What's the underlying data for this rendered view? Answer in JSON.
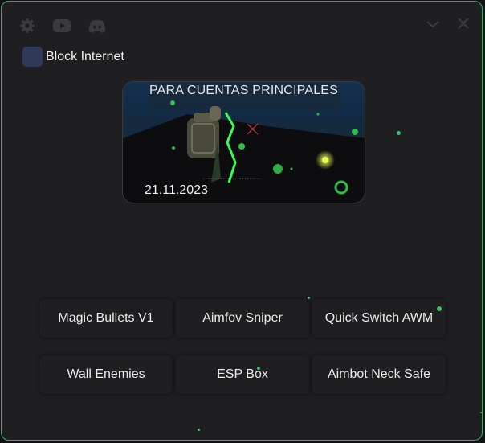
{
  "titlebar": {
    "icons": [
      "gear-icon",
      "youtube-icon",
      "discord-icon"
    ],
    "controls": [
      "chevron-down-icon",
      "close-icon"
    ]
  },
  "options": {
    "block_internet": {
      "label": "Block Internet",
      "checked": false
    }
  },
  "banner": {
    "title": "PARA CUENTAS PRINCIPALES",
    "date": "21.11.2023"
  },
  "buttons": [
    {
      "label": "Magic Bullets V1"
    },
    {
      "label": "Aimfov Sniper"
    },
    {
      "label": "Quick Switch AWM"
    },
    {
      "label": "Wall Enemies"
    },
    {
      "label": "ESP Box"
    },
    {
      "label": "Aimbot Neck Safe"
    }
  ],
  "colors": {
    "accent": "#3aa866",
    "background": "#1f1f22",
    "checkbox": "#2e3a57"
  }
}
